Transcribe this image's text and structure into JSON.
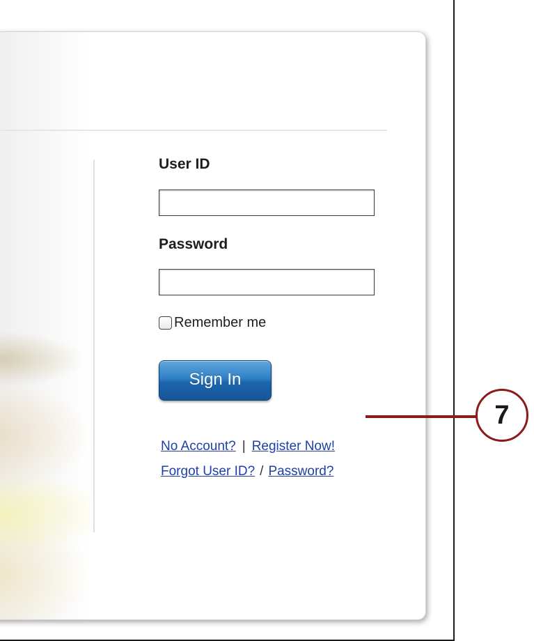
{
  "login_form": {
    "user_id_label": "User ID",
    "user_id_value": "",
    "password_label": "Password",
    "password_value": "",
    "remember_me_label": "Remember me",
    "remember_me_checked": false,
    "sign_in_label": "Sign In"
  },
  "links": {
    "no_account": "No Account?",
    "separator_1": "|",
    "register_now": "Register Now!",
    "forgot_user_id": "Forgot User ID?",
    "separator_2": "/",
    "password": "Password?"
  },
  "callout": {
    "number": "7"
  },
  "colors": {
    "button_blue": "#2f80c5",
    "link_blue": "#1f3fa8",
    "callout_red": "#8b1a1a"
  }
}
